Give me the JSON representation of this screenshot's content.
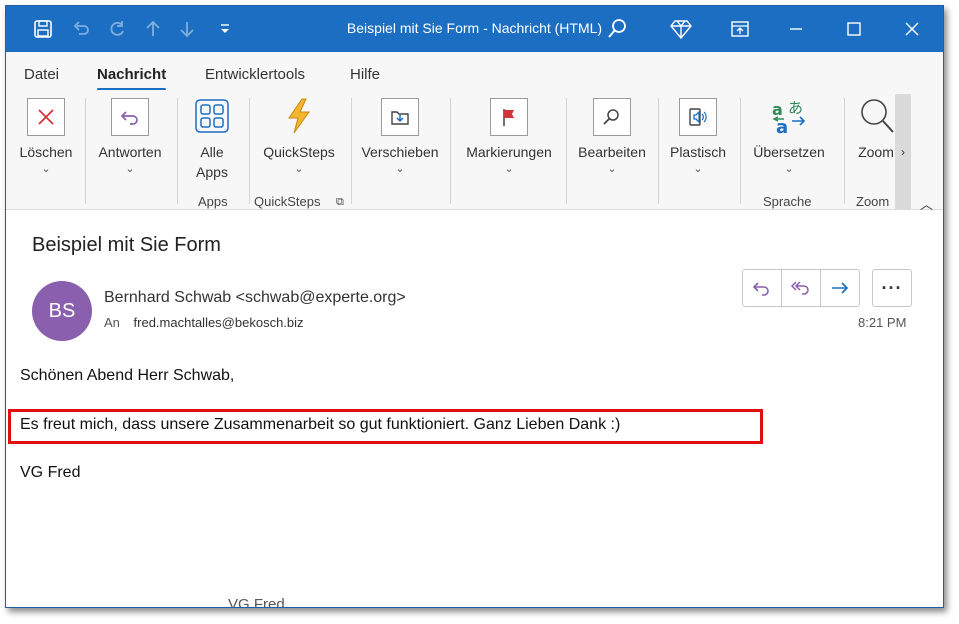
{
  "window": {
    "title": "Beispiel mit Sie Form  -  Nachricht (HTML)"
  },
  "menu": {
    "tabs": [
      "Datei",
      "Nachricht",
      "Entwicklertools",
      "Hilfe"
    ],
    "active": "Nachricht"
  },
  "ribbon": {
    "loeschen": "Löschen",
    "antworten": "Antworten",
    "alle_apps_1": "Alle",
    "alle_apps_2": "Apps",
    "quicksteps": "QuickSteps",
    "verschieben": "Verschieben",
    "markierungen": "Markierungen",
    "bearbeiten": "Bearbeiten",
    "plastisch": "Plastisch",
    "uebersetzen": "Übersetzen",
    "zoom": "Zoom",
    "groups": {
      "apps": "Apps",
      "quicksteps": "QuickSteps",
      "sprache": "Sprache",
      "zoom": "Zoom"
    }
  },
  "message": {
    "subject": "Beispiel mit Sie Form",
    "avatar_initials": "BS",
    "sender": "Bernhard Schwab <schwab@experte.org>",
    "to_label": "An",
    "to": "fred.machtalles@bekosch.biz",
    "time": "8:21 PM",
    "body": {
      "greeting": "Schönen Abend Herr Schwab,",
      "line1": "Es freut mich, dass unsere Zusammenarbeit so gut funktioniert. Ganz Lieben Dank :)",
      "signoff": "VG Fred"
    },
    "ghost_text": "VG Fred"
  },
  "colors": {
    "titlebar": "#1b6ec2",
    "accent_purple": "#8a5fae",
    "delete_red": "#d13438",
    "highlight": "#e01010"
  }
}
